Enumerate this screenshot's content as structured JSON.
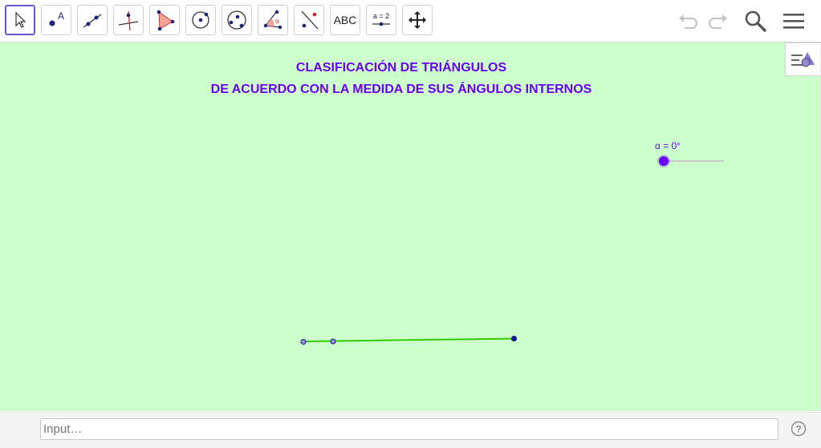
{
  "toolbar": {
    "tools": [
      {
        "name": "move-tool"
      },
      {
        "name": "point-tool",
        "label": "A"
      },
      {
        "name": "line-tool"
      },
      {
        "name": "perpendicular-line-tool"
      },
      {
        "name": "polygon-tool"
      },
      {
        "name": "circle-center-point-tool"
      },
      {
        "name": "circle-three-points-tool"
      },
      {
        "name": "angle-tool"
      },
      {
        "name": "reflect-tool"
      },
      {
        "name": "text-tool",
        "label": "ABC"
      },
      {
        "name": "slider-tool",
        "label": "a = 2"
      },
      {
        "name": "move-graphics-view-tool"
      }
    ],
    "active_tool": "move-tool"
  },
  "canvas": {
    "title_line1": "CLASIFICACIÓN DE TRIÁNGULOS",
    "title_line2": "DE ACUERDO CON LA MEDIDA DE SUS ÁNGULOS INTERNOS",
    "slider_label": "α = 0°",
    "slider_value": 0,
    "background": "#ccffcc",
    "title_color": "#6a00ff",
    "segment_color": "#33cc00"
  },
  "input": {
    "placeholder": "Input…"
  }
}
